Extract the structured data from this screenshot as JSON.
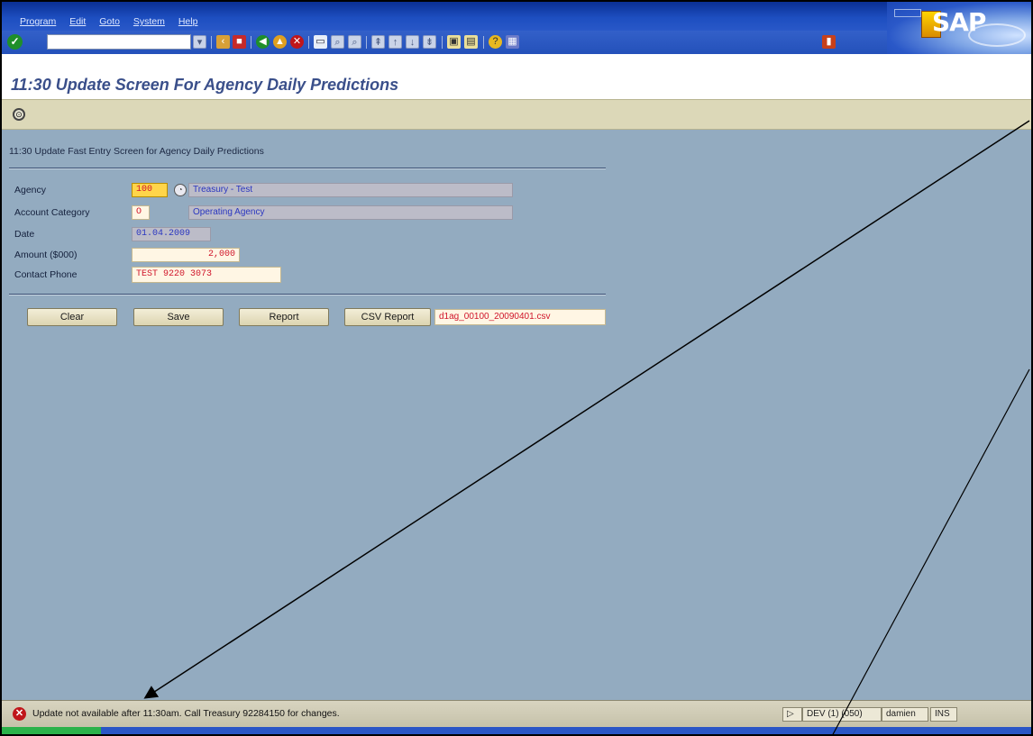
{
  "menu": [
    "Program",
    "Edit",
    "Goto",
    "System",
    "Help"
  ],
  "toolbar": {
    "command_value": ""
  },
  "page_title": "11:30 Update Screen For Agency Daily Predictions",
  "section_heading": "11:30 Update Fast Entry Screen for Agency Daily Predictions",
  "form": {
    "agency_label": "Agency",
    "agency_value": "100",
    "agency_desc": "Treasury - Test",
    "account_category_label": "Account Category",
    "account_category_value": "O",
    "account_category_desc": "Operating Agency",
    "date_label": "Date",
    "date_value": "01.04.2009",
    "amount_label": "Amount ($000)",
    "amount_value": "2,000",
    "contact_phone_label": "Contact Phone",
    "contact_phone_value": "TEST 9220 3073"
  },
  "buttons": {
    "clear": "Clear",
    "save": "Save",
    "report": "Report",
    "csv_report": "CSV Report",
    "csv_filename": "d1ag_00100_20090401.csv"
  },
  "status": {
    "message": "Update not available after 11:30am. Call Treasury 92284150 for changes.",
    "system": "DEV (1) (050)",
    "user": "damien",
    "mode": "INS"
  },
  "colors": {
    "main_background": "#93abc0",
    "input_text": "#d0152a",
    "display_text": "#2a36c0",
    "error": "#c0161a"
  }
}
